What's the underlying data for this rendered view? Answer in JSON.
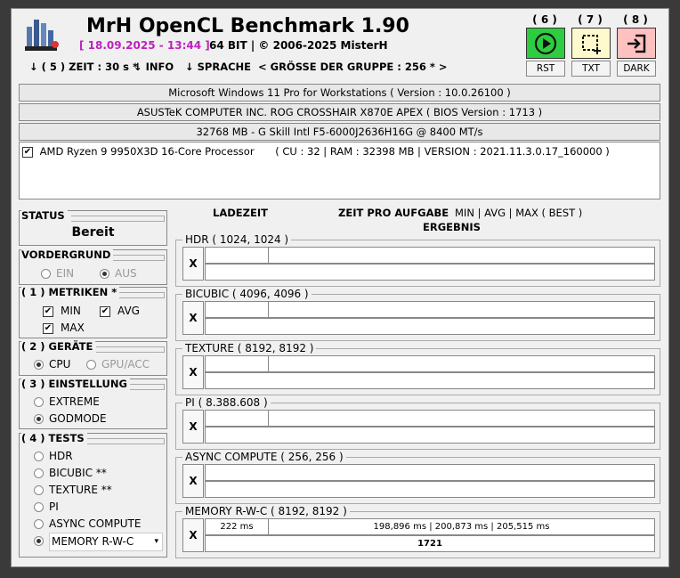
{
  "app": {
    "title": "MrH OpenCL Benchmark 1.90",
    "datetime": "[ 18.09.2025 - 13:44 ]",
    "bits": "64 BIT | ©  2006-2025 MisterH"
  },
  "menu": {
    "zeit": "↓ ( 5 ) ZEIT : 30 s *",
    "info": "↓ INFO",
    "sprache": "↓ SPRACHE",
    "gruppe": "< GRÖSSE DER GRUPPE : 256 * >"
  },
  "buttons": [
    {
      "num": "( 6 )",
      "label": "RST",
      "color": "#2ecc40",
      "icon": "play-icon"
    },
    {
      "num": "( 7 )",
      "label": "TXT",
      "color": "#fffacd",
      "icon": "crop-select-icon"
    },
    {
      "num": "( 8 )",
      "label": "DARK",
      "color": "#ffc0c0",
      "icon": "login-icon"
    }
  ],
  "system": {
    "os": "Microsoft Windows 11 Pro for Workstations ( Version : 10.0.26100 )",
    "board": "ASUSTeK COMPUTER INC. ROG CROSSHAIR X870E APEX ( BIOS Version : 1713 )",
    "ram": "32768 MB - G Skill Intl F5-6000J2636H16G            @ 8400 MT/s",
    "cpu_name": "AMD Ryzen 9 9950X3D 16-Core Processor",
    "cpu_info": "( CU : 32 | RAM : 32398 MB | VERSION : 2021.11.3.0.17_160000 )"
  },
  "status": {
    "title": "STATUS",
    "value": "Bereit"
  },
  "vordergrund": {
    "title": "VORDERGRUND",
    "ein": "EIN",
    "aus": "AUS"
  },
  "metriken": {
    "title": "( 1 ) METRIKEN *",
    "min": "MIN",
    "avg": "AVG",
    "max": "MAX"
  },
  "geraete": {
    "title": "( 2 ) GERÄTE",
    "cpu": "CPU",
    "gpu": "GPU/ACC"
  },
  "einstellung": {
    "title": "( 3 ) EINSTELLUNG",
    "extreme": "EXTREME",
    "godmode": "GODMODE"
  },
  "tests": {
    "title": "( 4 ) TESTS",
    "items": [
      "HDR",
      "BICUBIC **",
      "TEXTURE **",
      "PI",
      "ASYNC COMPUTE",
      "MEMORY R-W-C"
    ]
  },
  "headers": {
    "ladezeit": "LADEZEIT",
    "zeit": "ZEIT PRO AUFGABE",
    "minavg": "MIN | AVG | MAX ( BEST )",
    "ergebnis": "ERGEBNIS"
  },
  "results": [
    {
      "title": "HDR ( 1024, 1024 )",
      "load": "",
      "times": "",
      "result": ""
    },
    {
      "title": "BICUBIC ( 4096, 4096 )",
      "load": "",
      "times": "",
      "result": ""
    },
    {
      "title": "TEXTURE ( 8192, 8192 )",
      "load": "",
      "times": "",
      "result": ""
    },
    {
      "title": "PI ( 8.388.608 )",
      "load": "",
      "times": "",
      "result": ""
    },
    {
      "title": "ASYNC COMPUTE ( 256, 256 )",
      "load": "",
      "times": "",
      "result": ""
    },
    {
      "title": "MEMORY R-W-C ( 8192, 8192 )",
      "load": "222 ms",
      "times": "198,896 ms | 200,873 ms | 205,515 ms",
      "result": "1721"
    }
  ],
  "x_label": "X",
  "checkmark": "✔"
}
